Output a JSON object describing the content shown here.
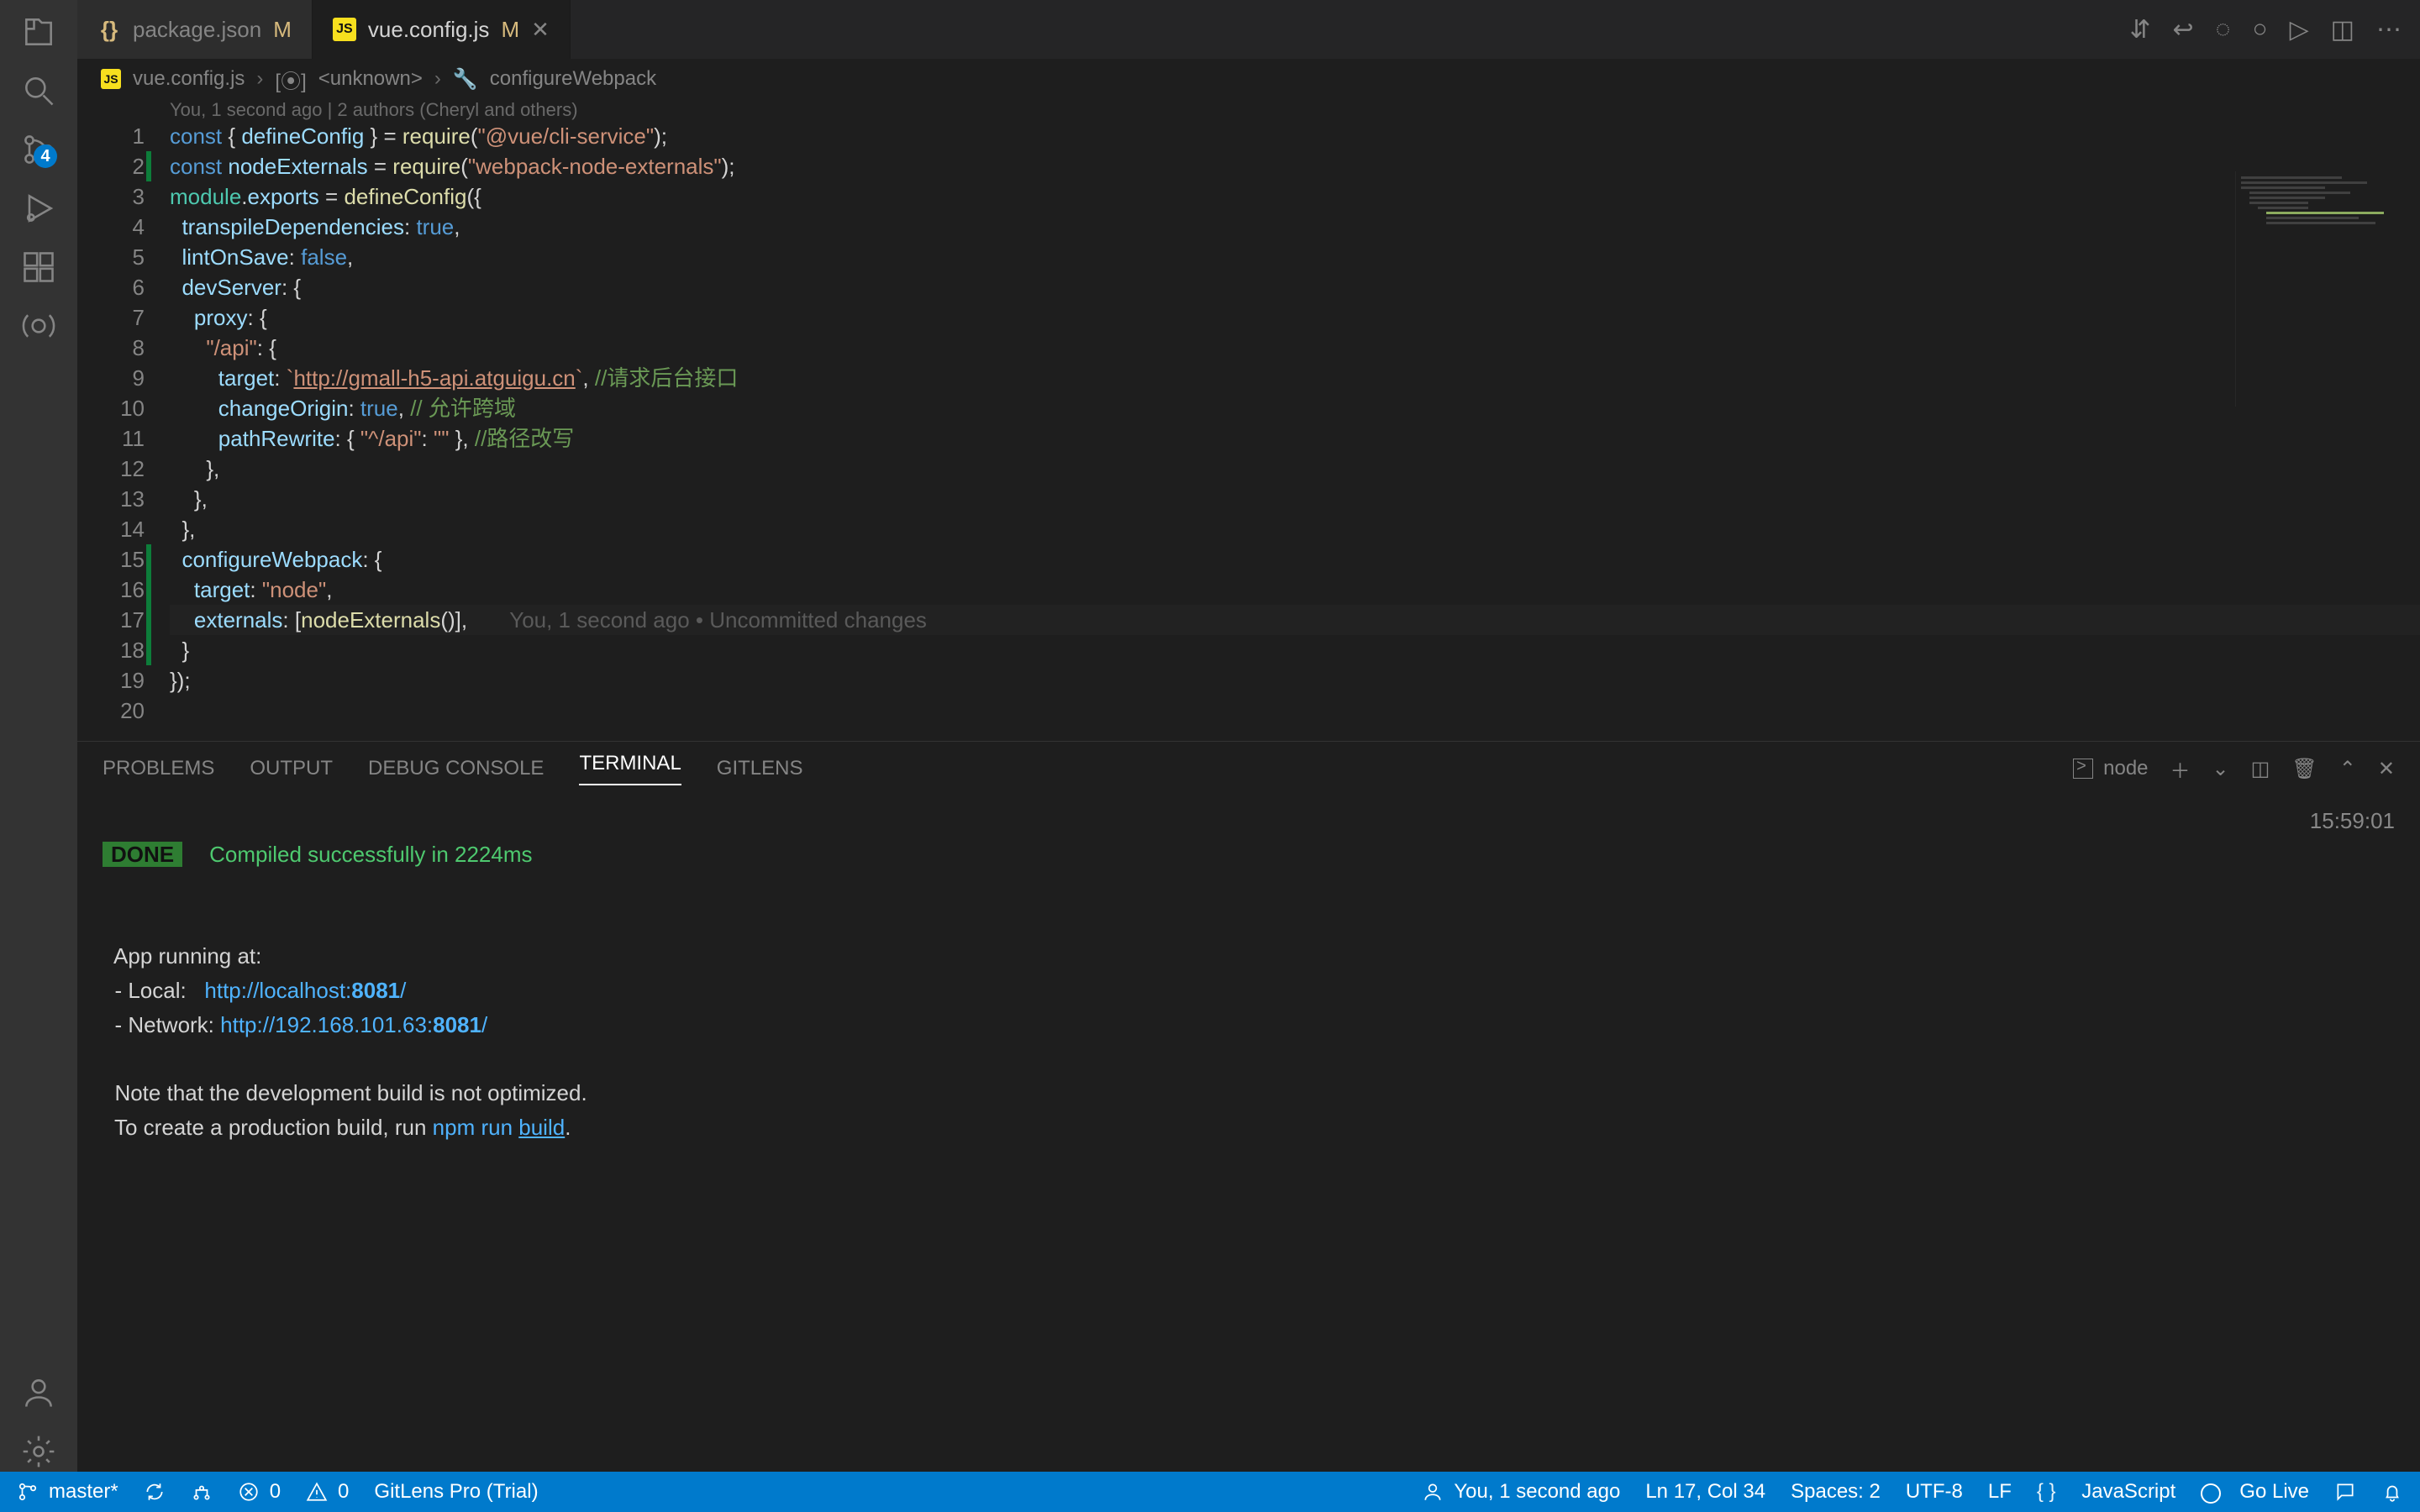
{
  "tabs": [
    {
      "icon": "braces",
      "label": "package.json",
      "modified": "M"
    },
    {
      "icon": "js",
      "label": "vue.config.js",
      "modified": "M"
    }
  ],
  "title_actions": [
    "git-compare",
    "git-pr",
    "circ",
    "dots",
    "play",
    "split",
    "more"
  ],
  "breadcrumbs": {
    "file_icon": "JS",
    "file": "vue.config.js",
    "module_icon": "[⦿]",
    "module": "<unknown>",
    "symbol_icon": "🔧",
    "symbol": "configureWebpack"
  },
  "authors_line": "You, 1 second ago | 2 authors (Cheryl and others)",
  "code_lines": [
    {
      "n": 1,
      "mod": false,
      "html": "<span class='kw'>const</span> <span class='punc'>{</span> <span class='prop'>defineConfig</span> <span class='punc'>}</span> <span class='punc'>=</span> <span class='fn'>require</span><span class='punc'>(</span><span class='str'>\"@vue/cli-service\"</span><span class='punc'>);</span>"
    },
    {
      "n": 2,
      "mod": true,
      "html": "<span class='kw'>const</span> <span class='prop'>nodeExternals</span> <span class='punc'>=</span> <span class='fn'>require</span><span class='punc'>(</span><span class='str'>\"webpack-node-externals\"</span><span class='punc'>);</span>"
    },
    {
      "n": 3,
      "mod": false,
      "html": "<span class='mod2'>module</span><span class='punc'>.</span><span class='prop'>exports</span> <span class='punc'>=</span> <span class='fn'>defineConfig</span><span class='punc'>({</span>"
    },
    {
      "n": 4,
      "mod": false,
      "html": "  <span class='prop'>transpileDependencies</span><span class='punc'>:</span> <span class='bool'>true</span><span class='punc'>,</span>"
    },
    {
      "n": 5,
      "mod": false,
      "html": "  <span class='prop'>lintOnSave</span><span class='punc'>:</span> <span class='bool'>false</span><span class='punc'>,</span>"
    },
    {
      "n": 6,
      "mod": false,
      "html": "  <span class='prop'>devServer</span><span class='punc'>:</span> <span class='punc'>{</span>"
    },
    {
      "n": 7,
      "mod": false,
      "html": "    <span class='prop'>proxy</span><span class='punc'>:</span> <span class='punc'>{</span>"
    },
    {
      "n": 8,
      "mod": false,
      "html": "      <span class='str'>\"/api\"</span><span class='punc'>:</span> <span class='punc'>{</span>"
    },
    {
      "n": 9,
      "mod": false,
      "html": "        <span class='prop'>target</span><span class='punc'>:</span> <span class='str'>`</span><span class='url'>http://gmall-h5-api.atguigu.cn</span><span class='str'>`</span><span class='punc'>,</span> <span class='cmt'>//请求后台接口</span>"
    },
    {
      "n": 10,
      "mod": false,
      "html": "        <span class='prop'>changeOrigin</span><span class='punc'>:</span> <span class='bool'>true</span><span class='punc'>,</span> <span class='cmt'>// 允许跨域</span>"
    },
    {
      "n": 11,
      "mod": false,
      "html": "        <span class='prop'>pathRewrite</span><span class='punc'>:</span> <span class='punc'>{</span> <span class='str'>\"^/api\"</span><span class='punc'>:</span> <span class='str'>\"\"</span> <span class='punc'>},</span> <span class='cmt'>//路径改写</span>"
    },
    {
      "n": 12,
      "mod": false,
      "html": "      <span class='punc'>},</span>"
    },
    {
      "n": 13,
      "mod": false,
      "html": "    <span class='punc'>},</span>"
    },
    {
      "n": 14,
      "mod": false,
      "html": "  <span class='punc'>},</span>"
    },
    {
      "n": 15,
      "mod": true,
      "html": "  <span class='prop'>configureWebpack</span><span class='punc'>:</span> <span class='punc'>{</span>"
    },
    {
      "n": 16,
      "mod": true,
      "html": "    <span class='prop'>target</span><span class='punc'>:</span> <span class='str'>\"node\"</span><span class='punc'>,</span>"
    },
    {
      "n": 17,
      "mod": true,
      "cur": true,
      "html": "    <span class='prop'>externals</span><span class='punc'>:</span> <span class='punc'>[</span><span class='fn'>nodeExternals</span><span class='punc'>()]</span><span class='punc'>,</span>       <span class='inline-blame'>You, 1 second ago • Uncommitted changes</span>"
    },
    {
      "n": 18,
      "mod": true,
      "html": "  <span class='punc'>}</span>"
    },
    {
      "n": 19,
      "mod": false,
      "html": "<span class='punc'>});</span>"
    },
    {
      "n": 20,
      "mod": false,
      "html": ""
    }
  ],
  "panel": {
    "tabs": [
      "PROBLEMS",
      "OUTPUT",
      "DEBUG CONSOLE",
      "TERMINAL",
      "GITLENS"
    ],
    "active_tab": "TERMINAL",
    "node_label": "node",
    "done_label": "DONE",
    "done_text": "Compiled successfully in 2224ms",
    "timestamp": "15:59:01",
    "lines": {
      "running": "  App running at:",
      "local_label": "  - Local:   ",
      "local_url": "http://localhost:",
      "local_port": "8081",
      "local_slash": "/",
      "network_label": "  - Network: ",
      "network_url": "http://192.168.101.63:",
      "network_port": "8081",
      "network_slash": "/",
      "note1": "  Note that the development build is not optimized.",
      "note2a": "  To create a production build, run ",
      "note2_cmd": "npm run ",
      "note2_build": "build",
      "note2_dot": "."
    }
  },
  "scm_badge": "4",
  "status": {
    "branch": "master*",
    "errors": "0",
    "warnings": "0",
    "gitlens": "GitLens Pro (Trial)",
    "blame": "You, 1 second ago",
    "lncol": "Ln 17, Col 34",
    "spaces": "Spaces: 2",
    "encoding": "UTF-8",
    "eol": "LF",
    "lang": "JavaScript",
    "golive": "Go Live"
  }
}
